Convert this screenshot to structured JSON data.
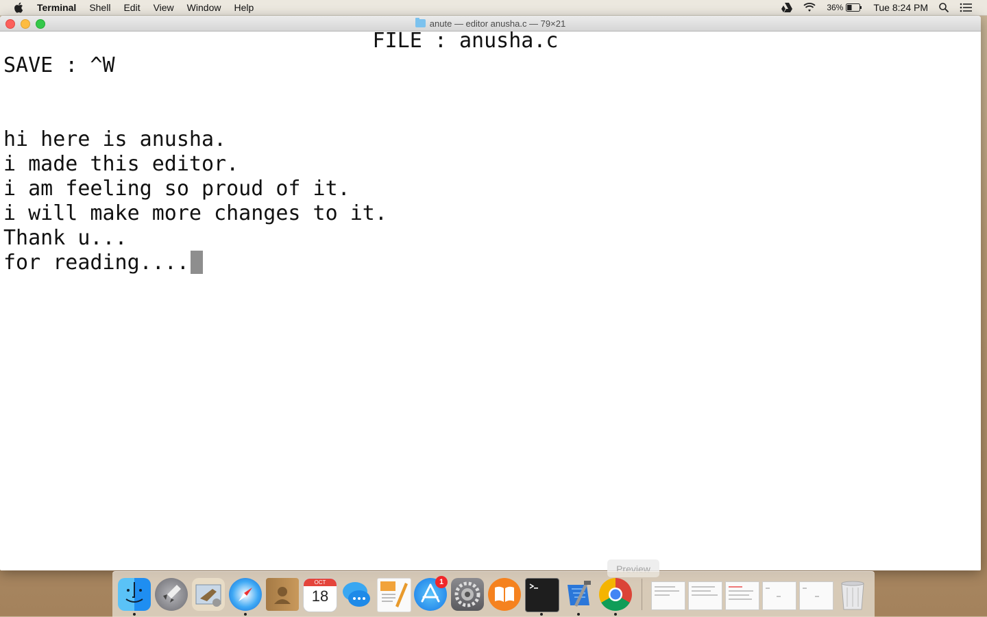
{
  "menubar": {
    "app_name": "Terminal",
    "items": [
      "Shell",
      "Edit",
      "View",
      "Window",
      "Help"
    ],
    "status": {
      "battery": "36%",
      "clock": "Tue 8:24 PM"
    }
  },
  "window": {
    "title": "anute — editor anusha.c — 79×21"
  },
  "terminal": {
    "file_header": "FILE : anusha.c",
    "save_hint": "SAVE : ^W",
    "lines": [
      "hi here is anusha.",
      "i made this editor.",
      "i am feeling so proud of it.",
      "i will make more changes to it.",
      "Thank u...",
      "for reading...."
    ]
  },
  "dock": {
    "tooltip": "Preview",
    "calendar_month": "OCT",
    "calendar_day": "18",
    "app_store_badge": "1",
    "apps": [
      "finder-icon",
      "launchpad-icon",
      "mail-icon",
      "safari-icon",
      "contacts-icon",
      "calendar-icon",
      "messages-icon",
      "pages-icon",
      "app-store-icon",
      "system-preferences-icon",
      "ibooks-icon",
      "terminal-icon",
      "xcode-icon",
      "chrome-icon"
    ]
  }
}
